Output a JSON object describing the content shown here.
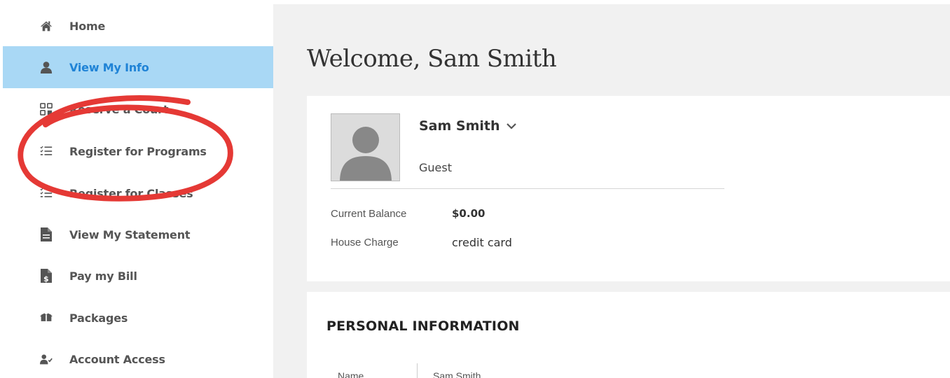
{
  "sidebar": {
    "items": [
      {
        "label": "Home",
        "icon": "home-icon",
        "active": false
      },
      {
        "label": "View My Info",
        "icon": "user-icon",
        "active": true
      },
      {
        "label": "Reserve a Court",
        "icon": "grid-icon",
        "active": false
      },
      {
        "label": "Register for Programs",
        "icon": "checklist-icon",
        "active": false
      },
      {
        "label": "Register for Classes",
        "icon": "checklist-icon",
        "active": false
      },
      {
        "label": "View My Statement",
        "icon": "document-icon",
        "active": false
      },
      {
        "label": "Pay my Bill",
        "icon": "bill-icon",
        "active": false
      },
      {
        "label": "Packages",
        "icon": "packages-icon",
        "active": false
      },
      {
        "label": "Account Access",
        "icon": "user-check-icon",
        "active": false
      }
    ]
  },
  "main": {
    "welcome": "Welcome, Sam Smith",
    "profile": {
      "name": "Sam Smith",
      "role": "Guest",
      "balance_label": "Current Balance",
      "balance_value": "$0.00",
      "house_charge_label": "House Charge",
      "house_charge_value": "credit card"
    },
    "personal": {
      "title": "PERSONAL INFORMATION",
      "name_label": "Name",
      "name_value": "Sam Smith"
    }
  },
  "colors": {
    "active_bg": "#a9d8f5",
    "active_text": "#1f83d6",
    "annotation": "#e53935",
    "main_bg": "#f1f1f1"
  }
}
